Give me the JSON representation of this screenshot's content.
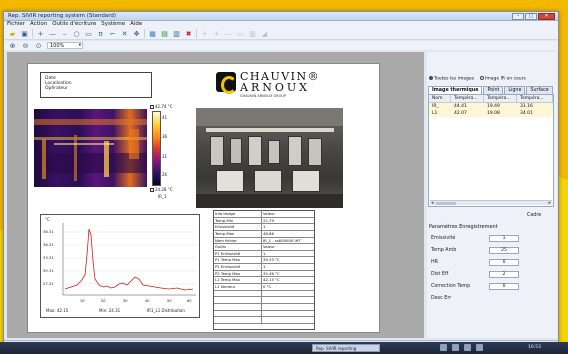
{
  "window": {
    "title": "Rep. SIVIR reporting system (Standard)",
    "buttons": [
      "–",
      "▢",
      "✕"
    ]
  },
  "menu": [
    "Fichier",
    "Action",
    "Outils d'écriture",
    "Système",
    "Aide"
  ],
  "toolbar": {
    "icons": [
      "open-folder-icon",
      "save-icon",
      "crosshair-icon",
      "line-icon",
      "minus-icon",
      "circle-icon",
      "rectangle-icon",
      "text-icon",
      "polyline-icon",
      "delete-icon",
      "move-icon",
      "palette-icon",
      "report-icon",
      "add-image-icon",
      "close-image-icon",
      "disabled-1-icon",
      "disabled-2-icon",
      "disabled-3-icon",
      "disabled-4-icon",
      "disabled-5-icon",
      "disabled-6-icon"
    ],
    "zoom_label": "100%"
  },
  "page": {
    "info": {
      "date": "Date",
      "location": "Localisation",
      "operator": "Opérateur"
    },
    "logo": {
      "line1": "CHAUVIN®",
      "line2": "ARNOUX",
      "sub": "CHAUVIN ARNOUX GROUP"
    },
    "colorbar": {
      "max": "42.74 °C",
      "min": "24.28 °C",
      "name": "IR_1",
      "ticks": [
        "41",
        "36",
        "31",
        "26"
      ]
    },
    "profile": {
      "y_ticks": [
        "38.31",
        "36.31",
        "33.31",
        "30.31",
        "27.31"
      ],
      "x_ticks": [
        "10",
        "20",
        "30",
        "40",
        "50",
        "60"
      ],
      "y_unit": "°C",
      "footer_max": "Max: 42.15",
      "footer_min": "Min: 24.31",
      "footer_name": "IR1_L1 Distribution"
    },
    "params": [
      [
        "Info Image",
        "Valeur"
      ],
      [
        "Temp Min",
        "22,79"
      ],
      [
        "Emissivité",
        "1"
      ],
      [
        "Temp Max",
        "48,66"
      ],
      [
        "Nom fichier",
        "IR_1 - ss650000.IHT"
      ],
      [
        "Outils",
        "Valeur"
      ],
      [
        "P1 Emissivité",
        "1"
      ],
      [
        "P1 Temp Max",
        "39,33 °C"
      ],
      [
        "P2 Emissivité",
        "1"
      ],
      [
        "P2 Temp Max",
        "35,46 °C"
      ],
      [
        "L1 Temp Max",
        "42,15 °C"
      ],
      [
        "L1 Vecteur",
        "0 °C"
      ],
      [
        "",
        ""
      ],
      [
        "",
        ""
      ],
      [
        "",
        ""
      ],
      [
        "",
        ""
      ],
      [
        "",
        ""
      ]
    ]
  },
  "side": {
    "radio_all": "Toutes les images",
    "radio_ir": "Image IR en cours",
    "tabs": [
      "Image thermique",
      "Point",
      "Ligne",
      "Surface"
    ],
    "table_headers": [
      "Nom",
      "Tempéra...",
      "Tempéra...",
      "Tempéra..."
    ],
    "table_rows": [
      [
        "IR_",
        "44.41",
        "19.49",
        "31.16"
      ],
      [
        "L1",
        "42.07",
        "19.08",
        "34.01"
      ]
    ],
    "cadre": "Cadre",
    "settings_title": "Paramètres Enregistrement",
    "settings": [
      {
        "label": "Emissivité",
        "value": "1"
      },
      {
        "label": "Temp Amb",
        "value": "25"
      },
      {
        "label": "HR",
        "value": "0"
      },
      {
        "label": "Dist Eff",
        "value": "2"
      },
      {
        "label": "Correction Temp",
        "value": "0"
      },
      {
        "label": "Desc Err",
        "value": ""
      }
    ]
  },
  "taskbar": {
    "active_task": "Rep. SIVIR reporting",
    "clock": "16:53"
  }
}
